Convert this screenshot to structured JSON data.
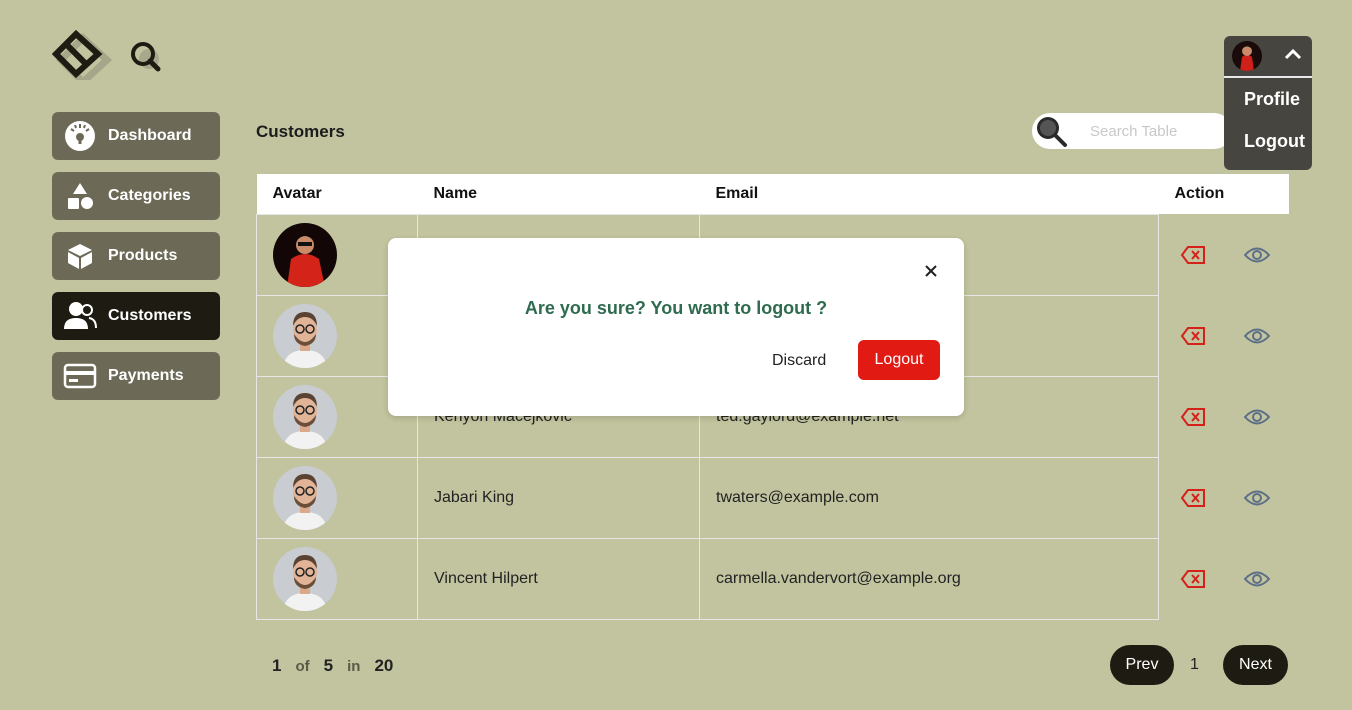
{
  "sidebar": {
    "items": [
      {
        "label": "Dashboard",
        "icon": "gauge-icon"
      },
      {
        "label": "Categories",
        "icon": "shapes-icon"
      },
      {
        "label": "Products",
        "icon": "box-icon"
      },
      {
        "label": "Customers",
        "icon": "users-icon",
        "active": true
      },
      {
        "label": "Payments",
        "icon": "card-icon"
      }
    ]
  },
  "header": {
    "page_title": "Customers",
    "search_placeholder": "Search Table"
  },
  "user_menu": {
    "items": [
      "Profile",
      "Logout"
    ]
  },
  "table": {
    "columns": [
      "Avatar",
      "Name",
      "Email",
      "Action"
    ],
    "rows": [
      {
        "name": "",
        "email": "",
        "avatar": "red-jacket"
      },
      {
        "name": "",
        "email": "",
        "avatar": "glasses-man"
      },
      {
        "name": "Kenyon Macejkovic",
        "email": "ted.gaylord@example.net",
        "avatar": "glasses-man"
      },
      {
        "name": "Jabari King",
        "email": "twaters@example.com",
        "avatar": "glasses-man"
      },
      {
        "name": "Vincent Hilpert",
        "email": "carmella.vandervort@example.org",
        "avatar": "glasses-man"
      }
    ]
  },
  "pagination": {
    "current": "1",
    "of_label": "of",
    "total_pages": "5",
    "in_label": "in",
    "total_items": "20",
    "prev_label": "Prev",
    "page": "1",
    "next_label": "Next"
  },
  "modal": {
    "question": "Are you sure? You want to logout ?",
    "discard_label": "Discard",
    "confirm_label": "Logout"
  },
  "colors": {
    "background": "#c2c49f",
    "sidebar_item": "#6c6a56",
    "sidebar_active": "#1e1c12",
    "danger": "#e11a14",
    "question_text": "#2f6b4f"
  }
}
